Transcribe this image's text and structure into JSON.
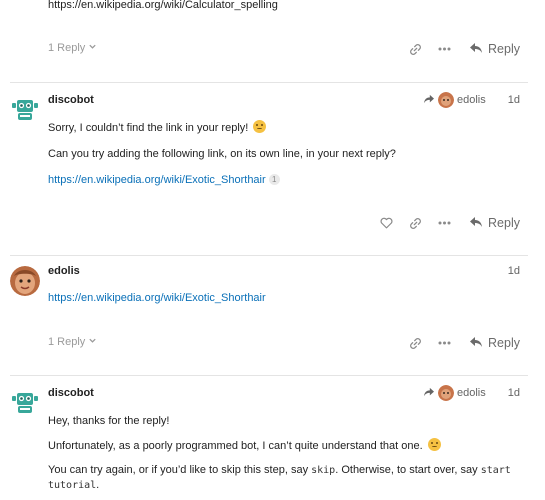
{
  "top_post": {
    "link": "https://en.wikipedia.org/wiki/Calculator_spelling",
    "replies_label": "1 Reply",
    "reply_label": "Reply"
  },
  "post1": {
    "username": "discobot",
    "reply_to_user": "edolis",
    "date": "1d",
    "line1": "Sorry, I couldn’t find the link in your reply!",
    "line2": "Can you try adding the following link, on its own line, in your next reply?",
    "link": "https://en.wikipedia.org/wiki/Exotic_Shorthair",
    "link_count": "1",
    "reply_label": "Reply"
  },
  "post2": {
    "username": "edolis",
    "date": "1d",
    "link": "https://en.wikipedia.org/wiki/Exotic_Shorthair",
    "replies_label": "1 Reply",
    "reply_label": "Reply"
  },
  "post3": {
    "username": "discobot",
    "reply_to_user": "edolis",
    "date": "1d",
    "line1": "Hey, thanks for the reply!",
    "line2": "Unfortunately, as a poorly programmed bot, I can’t quite understand that one.",
    "line3_a": "You can try again, or if you’d like to skip this step, say ",
    "line3_code1": "skip",
    "line3_b": ". Otherwise, to start over, say ",
    "line3_code2": "start",
    "line3_code3": "tutorial",
    "line3_c": "."
  },
  "icons": {
    "bot_color": "#38a79a",
    "link_color": "#0a70b8"
  }
}
